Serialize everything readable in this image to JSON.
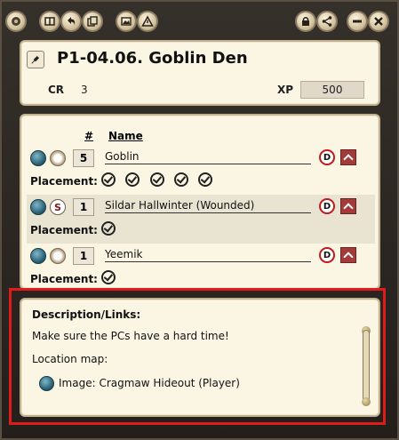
{
  "window": {
    "toolbar_left": [
      "logo-icon",
      "split-view-icon",
      "back-icon",
      "copy-icon",
      "image-icon",
      "warning-icon"
    ],
    "toolbar_right": [
      "lock-icon",
      "share-icon",
      "minimize-icon",
      "close-icon"
    ]
  },
  "header": {
    "title": "P1-04.06. Goblin Den",
    "cr_label": "CR",
    "cr_value": "3",
    "xp_label": "XP",
    "xp_value": "500"
  },
  "list": {
    "col_num": "#",
    "col_name": "Name",
    "placement_label": "Placement:",
    "entries": [
      {
        "count": "5",
        "name": "Goblin",
        "token": "goblin-token-icon",
        "placements": 5
      },
      {
        "count": "1",
        "name": "Sildar Hallwinter (Wounded)",
        "token": "s-token",
        "token_letter": "S",
        "placements": 1
      },
      {
        "count": "1",
        "name": "Yeemik",
        "token": "goblin-token-icon",
        "placements": 1
      }
    ],
    "nolink_glyph": "D"
  },
  "description": {
    "title": "Description/Links:",
    "line1": "Make sure the PCs have a hard time!",
    "line2": "Location map:",
    "link_text": "Image: Cragmaw Hideout (Player)"
  },
  "colors": {
    "highlight": "#e01b1b",
    "parchment": "#fbf6e4",
    "delete": "#a33b3b"
  }
}
